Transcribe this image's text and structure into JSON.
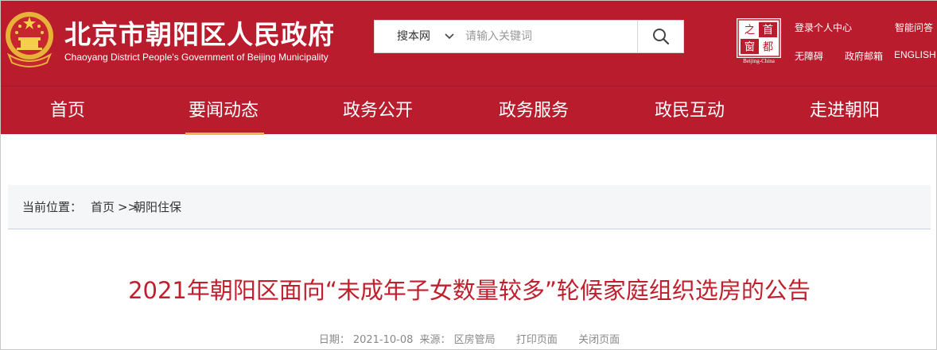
{
  "header": {
    "title": "北京市朝阳区人民政府",
    "subtitle": "Chaoyang District People's Government of Beijing Municipality",
    "search": {
      "scope": "搜本网",
      "placeholder": "请输入关键词"
    },
    "capital_logo": {
      "chars": [
        "首",
        "都",
        "之",
        "窗"
      ],
      "caption": "Beijing-China"
    },
    "links": {
      "login": "登录个人中心",
      "smart_qa": "智能问答",
      "accessibility": "无障碍",
      "gov_mail": "政府邮箱",
      "english": "ENGLISH"
    }
  },
  "nav": {
    "items": [
      "首页",
      "要闻动态",
      "政务公开",
      "政务服务",
      "政民互动",
      "走进朝阳"
    ],
    "active_index": 1
  },
  "breadcrumb": {
    "label": "当前位置：",
    "home": "首页",
    "separator": ">>",
    "current": "朝阳住保"
  },
  "article": {
    "title": "2021年朝阳区面向“未成年子女数量较多”轮候家庭组织选房的公告",
    "meta": {
      "date_label": "日期：",
      "date": "2021-10-08",
      "source_label": "来源：",
      "source": "区房管局",
      "print": "打印页面",
      "close": "关闭页面"
    }
  },
  "colors": {
    "brand_red": "#b91c2c",
    "title_red": "#c0202e",
    "active_gold": "#f2b84b"
  },
  "icons": [
    "national-emblem-icon",
    "chevron-down-icon",
    "search-icon",
    "capital-window-logo"
  ]
}
